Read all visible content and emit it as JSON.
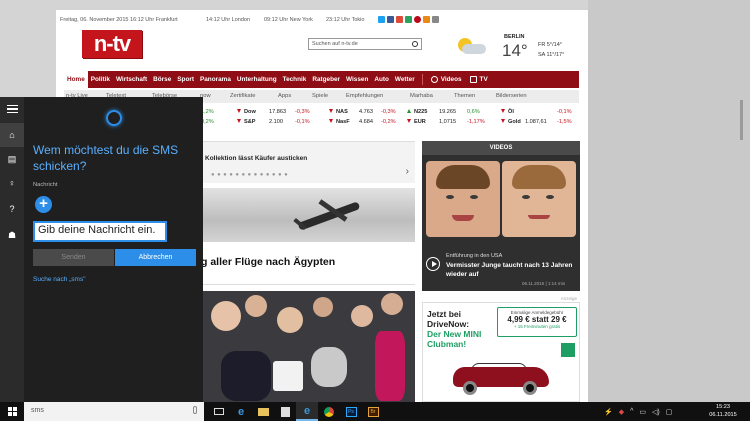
{
  "site": {
    "infobar": {
      "date": "Freitag, 06. November 2015 16:12 Uhr Frankfurt",
      "london": "14:12 Uhr London",
      "newyork": "09:12 Uhr New York",
      "tokio": "23:12 Uhr Tokio"
    },
    "logo": "n-tv",
    "search_placeholder": "Suchen auf n-tv.de",
    "weather": {
      "city": "BERLIN",
      "temp": "14°",
      "fr": "FR   5°/14°",
      "sa": "SA  11°/17°"
    },
    "nav": [
      "Home",
      "Politik",
      "Wirtschaft",
      "Börse",
      "Sport",
      "Panorama",
      "Unterhaltung",
      "Technik",
      "Ratgeber",
      "Wissen",
      "Auto",
      "Wetter"
    ],
    "nav_videos": "Videos",
    "nav_tv": "TV",
    "subnav": [
      "n-tv Live",
      "Teletext",
      "Telebörse",
      "now",
      "Zertifikate",
      "Apps",
      "Spiele",
      "Empfehlungen",
      "Marhaba",
      "Themen",
      "Bilderserien"
    ],
    "ticker": [
      [
        {
          "dir": "up",
          "name": "",
          "val": "",
          "chg": "1,2%"
        },
        {
          "dir": "up",
          "name": "",
          "val": "",
          "chg": "0,2%"
        }
      ],
      [
        {
          "dir": "dn",
          "name": "Dow",
          "val": "17.863",
          "chg": "-0,3%"
        },
        {
          "dir": "dn",
          "name": "S&P",
          "val": "2.100",
          "chg": "-0,1%"
        }
      ],
      [
        {
          "dir": "dn",
          "name": "NAS",
          "val": "4.763",
          "chg": "-0,3%"
        },
        {
          "dir": "dn",
          "name": "NasF",
          "val": "4.684",
          "chg": "-0,2%"
        }
      ],
      [
        {
          "dir": "up",
          "name": "N225",
          "val": "19.265",
          "chg": "0,6%"
        },
        {
          "dir": "dn",
          "name": "EUR",
          "val": "1,0715",
          "chg": "-1,17%"
        }
      ],
      [
        {
          "dir": "dn",
          "name": "Öl",
          "val": "",
          "chg": "-0,1%"
        },
        {
          "dir": "dn",
          "name": "Gold",
          "val": "1.087,61",
          "chg": "-1,5%"
        }
      ]
    ],
    "teaser_headline": "Kollektion lässt Käufer austicken",
    "headline2": "g aller Flüge nach Ägypten",
    "videos": {
      "title": "VIDEOS",
      "kicker": "Entführung in den USA",
      "headline": "Vermisster Junge taucht nach 13 Jahren wieder auf",
      "date": "06.11.2015 | 1:14 min"
    },
    "ad": {
      "label": "Anzeige",
      "line1": "Jetzt bei DriveNow:",
      "line2": "Der New MINI Clubman!",
      "box_top": "Einmalige Anmeldegebühr",
      "price": "4,99 € statt 29 €",
      "bonus": "+ 15 Freiminuten gratis"
    }
  },
  "cortana": {
    "question": "Wem möchtest du die SMS schicken?",
    "recipient_label": "Nachricht",
    "message_placeholder": "Gib deine Nachricht ein.",
    "send_label": "Senden",
    "cancel_label": "Abbrechen",
    "search_link": "Suche nach „sms\""
  },
  "taskbar": {
    "search_value": "sms",
    "time": "15:23",
    "date": "06.11.2015"
  },
  "colors": {
    "ntv_red": "#c4141c",
    "nav_red": "#8f0d14",
    "cortana_accent": "#2c8ee8"
  }
}
